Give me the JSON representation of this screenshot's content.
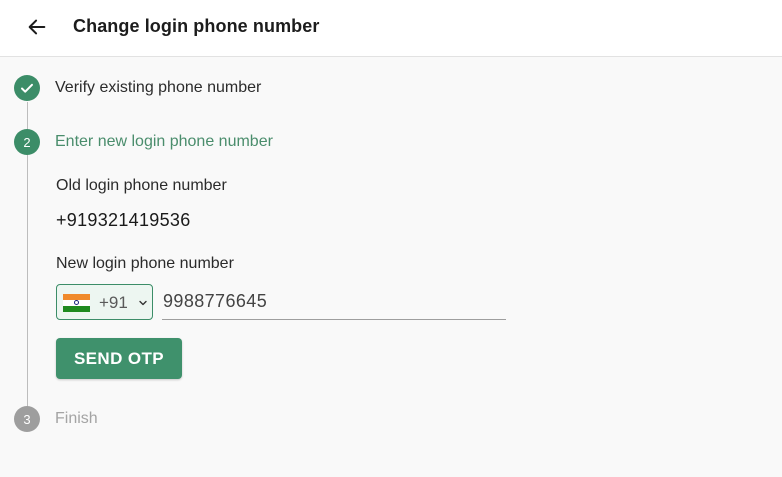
{
  "header": {
    "title": "Change login phone number",
    "back_icon": "arrow-left-icon"
  },
  "steps": [
    {
      "number": "1",
      "label": "Verify existing phone number",
      "status": "completed",
      "icon": "check-icon"
    },
    {
      "number": "2",
      "label": "Enter new login phone number",
      "status": "active"
    },
    {
      "number": "3",
      "label": "Finish",
      "status": "pending"
    }
  ],
  "form": {
    "old_label": "Old login phone number",
    "old_value": "+919321419536",
    "new_label": "New login phone number",
    "country": {
      "flag_icon": "india-flag-icon",
      "dial_code": "+91"
    },
    "phone_value": "9988776645",
    "submit_label": "SEND OTP"
  },
  "colors": {
    "accent": "#3c8d68",
    "active_text": "#4a8d6c",
    "pending": "#9e9e9e"
  }
}
